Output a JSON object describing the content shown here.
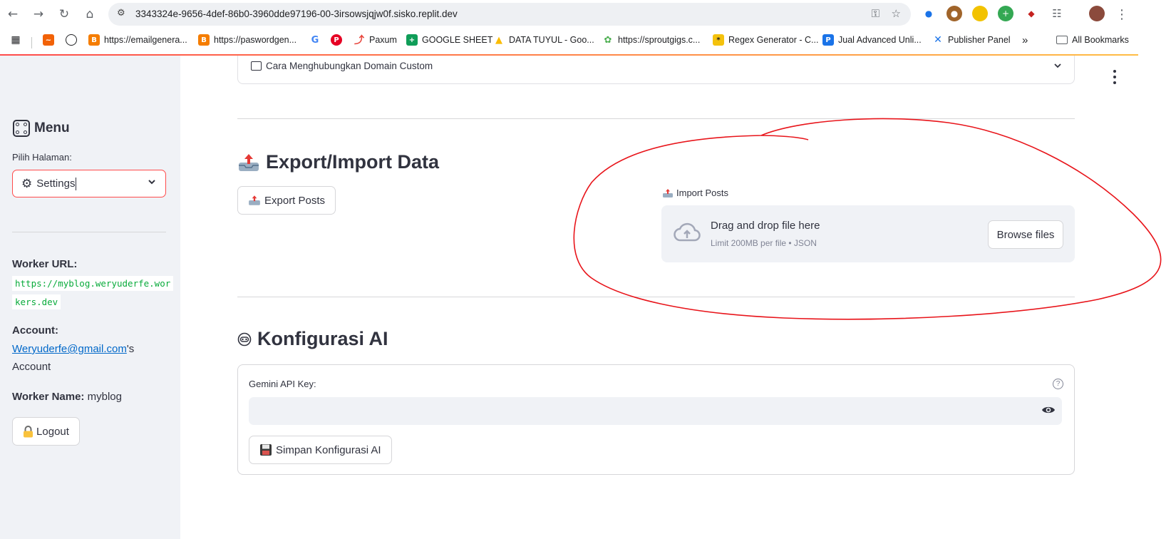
{
  "browser": {
    "url": "3343324e-9656-4def-86b0-3960dde97196-00-3irsowsjqjw0f.sisko.replit.dev",
    "bookmarks": [
      {
        "label": "",
        "icon": "replit-icon",
        "color": "#f26207"
      },
      {
        "label": "",
        "icon": "chatgpt-icon",
        "color": "#202124"
      },
      {
        "label": "https://emailgenera...",
        "icon": "blogger-icon",
        "color": "#f57d00"
      },
      {
        "label": "https://paswordgen...",
        "icon": "blogger-icon",
        "color": "#f57d00"
      },
      {
        "label": "",
        "icon": "google-icon",
        "color": "#4285f4"
      },
      {
        "label": "",
        "icon": "pinterest-icon",
        "color": "#e60023"
      },
      {
        "label": "Paxum",
        "icon": "paxum-icon",
        "color": "#e8453c"
      },
      {
        "label": "GOOGLE SHEET",
        "icon": "sheets-icon",
        "color": "#0f9d58"
      },
      {
        "label": "DATA TUYUL - Goo...",
        "icon": "drive-icon",
        "color": "#fbbc04"
      },
      {
        "label": "https://sproutgigs.c...",
        "icon": "sproutgigs-icon",
        "color": "#4caf50"
      },
      {
        "label": "Regex Generator - C...",
        "icon": "regex-icon",
        "color": "#f4c20d"
      },
      {
        "label": "Jual Advanced Unli...",
        "icon": "paypal-icon",
        "color": "#1a73e8"
      },
      {
        "label": "Publisher Panel",
        "icon": "publisher-icon",
        "color": "#1a73e8"
      }
    ],
    "all_bookmarks_label": "All Bookmarks"
  },
  "sidebar": {
    "menu_title": "Menu",
    "page_select_label": "Pilih Halaman:",
    "page_select_value": "Settings",
    "worker_url_label": "Worker URL:",
    "worker_url_line1": "https://myblog.weryuderfe.wor",
    "worker_url_line2": "kers.dev",
    "account_label": "Account:",
    "account_email": "Weryuderfe@gmail.com",
    "account_suffix": "'s",
    "account_word": "Account",
    "worker_name_label": "Worker Name:",
    "worker_name_value": "myblog",
    "logout_label": "Logout"
  },
  "main": {
    "expander_label": "Cara Menghubungkan Domain Custom",
    "export_import": {
      "heading": "Export/Import Data",
      "export_button": "Export Posts",
      "import_label": "Import Posts",
      "dropzone_title": "Drag and drop file here",
      "dropzone_limit": "Limit 200MB per file • JSON",
      "browse_button": "Browse files"
    },
    "ai_config": {
      "heading": "Konfigurasi AI",
      "api_key_label": "Gemini API Key:",
      "api_key_value": "",
      "save_button": "Simpan Konfigurasi AI"
    }
  },
  "colors": {
    "primary": "#ff4b4b",
    "sidebar_bg": "#f0f2f6",
    "link": "#0068c9",
    "code_text": "#09ab3b",
    "annotation": "#e8141a"
  }
}
